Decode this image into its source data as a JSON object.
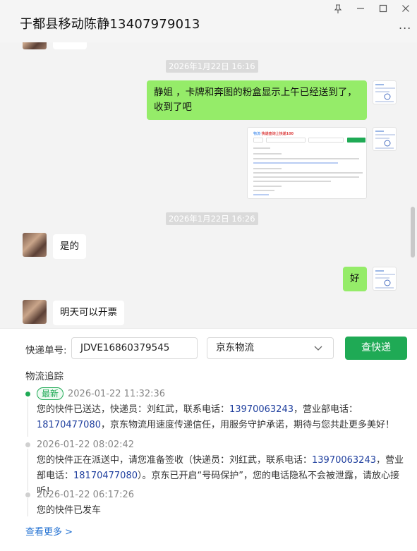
{
  "window": {
    "title": "于都县移动陈静13407979013",
    "more_label": "..."
  },
  "chat": {
    "timestamps": [
      "2026年1月22日 16:16",
      "2026年1月22日 16:26"
    ],
    "messages": [
      {
        "side": "right",
        "text": "静姐 ，卡牌和奔图的粉盒显示上午已经送到了，收到了吧"
      },
      {
        "side": "right",
        "type": "image"
      },
      {
        "side": "left",
        "text": "是的"
      },
      {
        "side": "right",
        "text": "好"
      },
      {
        "side": "left",
        "text": "明天可以开票"
      }
    ],
    "image_thumb": {
      "title_prefix": "物流·",
      "title_main": "快递查询上快递100"
    }
  },
  "tracking": {
    "number_label": "快递单号:",
    "number_value": "JDVE16860379545",
    "carrier_value": "京东物流",
    "search_button": "查快递",
    "section_title": "物流追踪",
    "latest_badge": "最新",
    "events": [
      {
        "time": "2026-01-22 11:32:36",
        "parts": [
          "您的快件已送达，快递员：刘红武，联系电话：",
          "13970063243",
          "，营业部电话：",
          "18170477080",
          "，京东物流用速度传递信任，用服务守护承诺，期待与您共赴更多美好！"
        ]
      },
      {
        "time": "2026-01-22 08:02:42",
        "parts": [
          "您的快件正在派送中，请您准备签收（快递员：刘红武，联系电话：",
          "13970063243",
          "，营业部电话：",
          "18170477080",
          "）。京东已开启“号码保护”，您的电话隐私不会被泄露，请放心接听！"
        ]
      },
      {
        "time": "2026-01-22 06:17:26",
        "parts": [
          "您的快件已发车"
        ]
      }
    ],
    "more_link": "查看更多 >"
  },
  "colors": {
    "accent_green": "#1faa55",
    "bubble_green": "#95ec69",
    "phone_blue": "#1f3f9e",
    "link_blue": "#1f6fd1"
  },
  "icons": [
    "pin-icon",
    "minimize-icon",
    "maximize-icon",
    "close-icon",
    "more-icon",
    "chevron-down-icon"
  ]
}
